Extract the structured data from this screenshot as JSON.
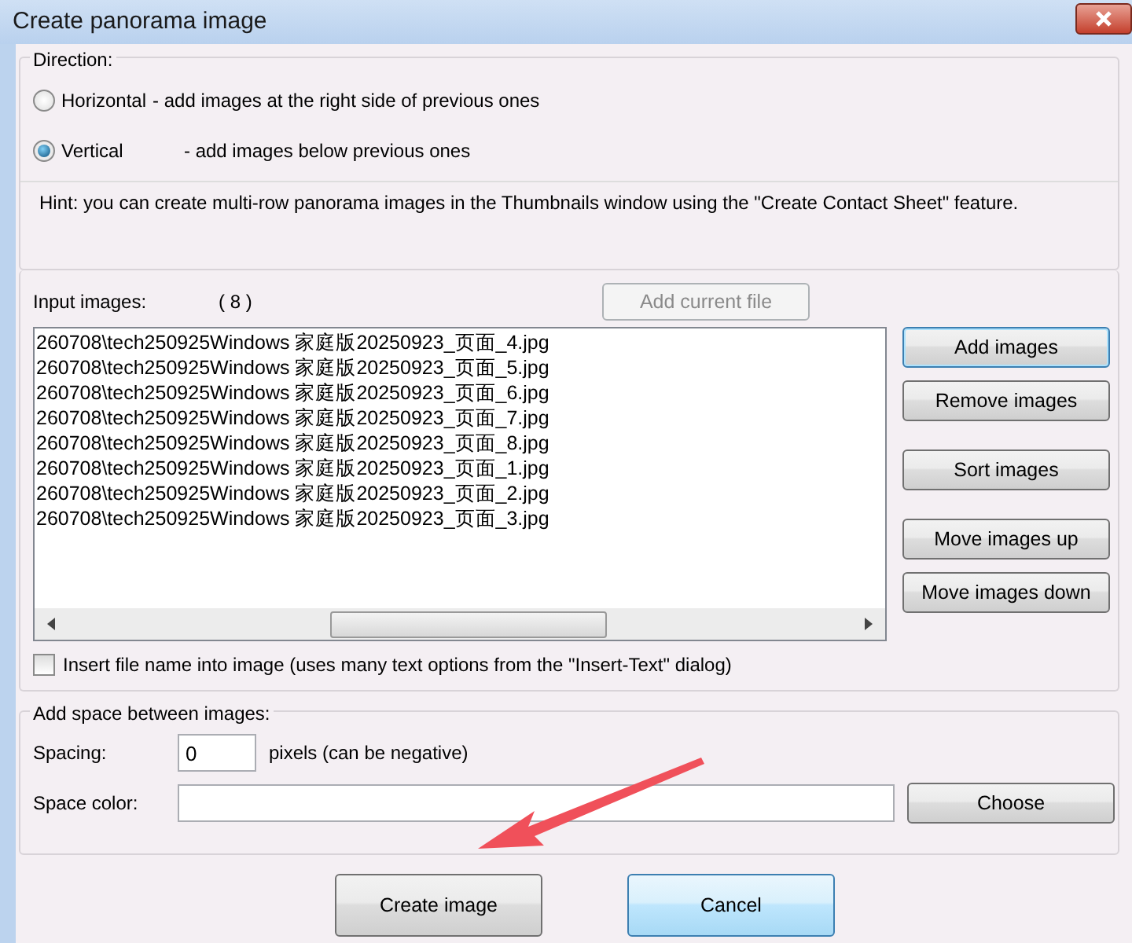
{
  "window": {
    "title": "Create panorama image"
  },
  "direction": {
    "legend": "Direction:",
    "options": [
      {
        "label": "Horizontal",
        "description": "- add images at the right side of previous ones",
        "selected": false
      },
      {
        "label": "Vertical",
        "description": "- add images below previous ones",
        "selected": true
      }
    ]
  },
  "hint": "Hint: you can create multi-row panorama images in the Thumbnails window using the \"Create Contact Sheet\" feature.",
  "input_images": {
    "label": "Input images:",
    "count": "( 8 )",
    "add_current_button": {
      "label": "Add current file",
      "disabled": true
    },
    "files": [
      "260708\\tech250925Windows 家庭版20250923_页面_4.jpg",
      "260708\\tech250925Windows 家庭版20250923_页面_5.jpg",
      "260708\\tech250925Windows 家庭版20250923_页面_6.jpg",
      "260708\\tech250925Windows 家庭版20250923_页面_7.jpg",
      "260708\\tech250925Windows 家庭版20250923_页面_8.jpg",
      "260708\\tech250925Windows 家庭版20250923_页面_1.jpg",
      "260708\\tech250925Windows 家庭版20250923_页面_2.jpg",
      "260708\\tech250925Windows 家庭版20250923_页面_3.jpg"
    ],
    "button_groups": [
      [
        {
          "label": "Add images",
          "focused": true
        },
        {
          "label": "Remove images",
          "focused": false
        }
      ],
      [
        {
          "label": "Sort images",
          "focused": false
        }
      ],
      [
        {
          "label": "Move images up",
          "focused": false
        },
        {
          "label": "Move images down",
          "focused": false
        }
      ]
    ],
    "insert_file_name": {
      "label": "Insert file name into image (uses many text options from the \"Insert-Text\" dialog)",
      "checked": false
    }
  },
  "space": {
    "legend": "Add space between images:",
    "spacing_label": "Spacing:",
    "spacing_value": "0",
    "spacing_unit": "pixels (can be negative)",
    "color_label": "Space color:",
    "choose_button": "Choose"
  },
  "buttons": [
    {
      "label": "Create image",
      "highlighted": false
    },
    {
      "label": "Cancel",
      "highlighted": true
    }
  ]
}
